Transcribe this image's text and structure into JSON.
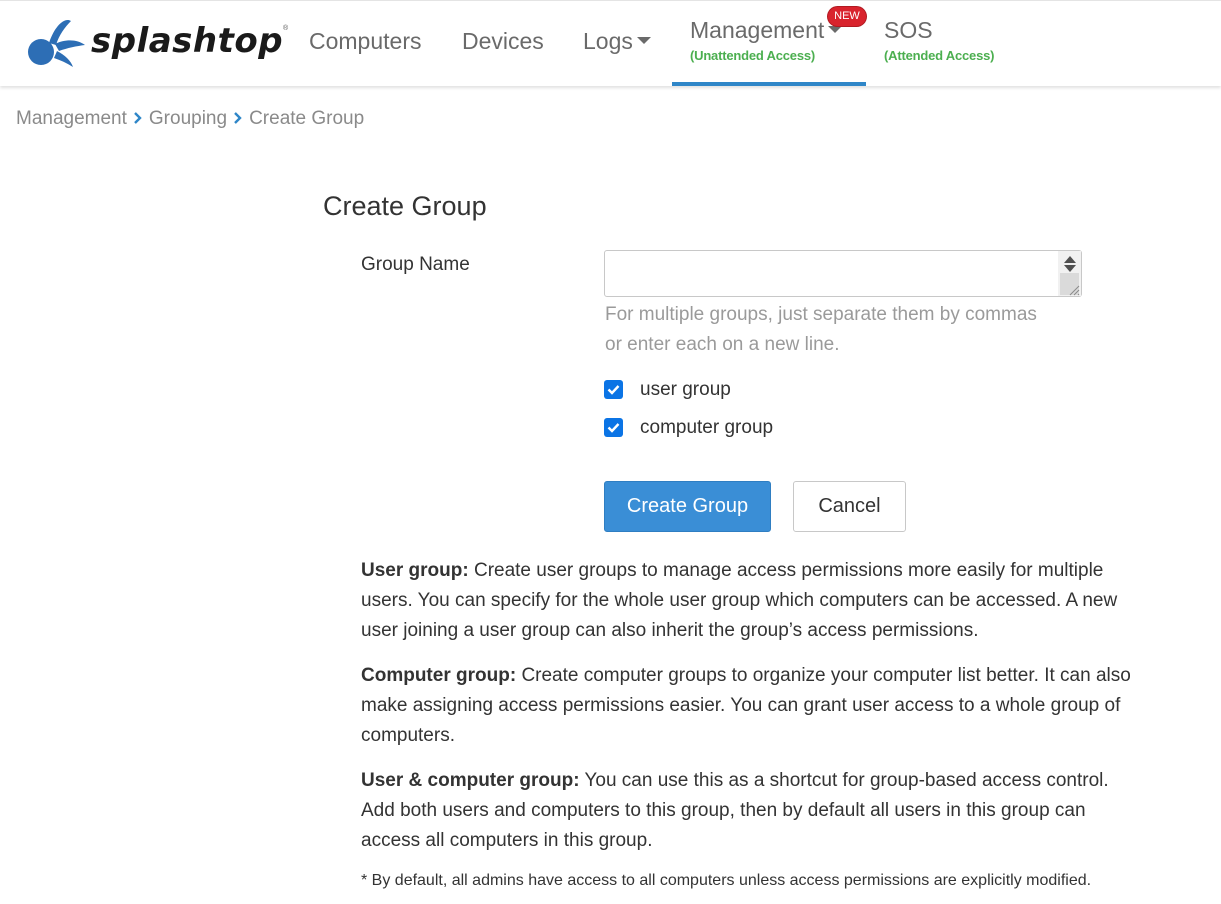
{
  "brand": {
    "name": "splashtop",
    "registered": "®"
  },
  "nav": {
    "computers": "Computers",
    "devices": "Devices",
    "logs": "Logs",
    "management": {
      "label": "Management",
      "sub": "(Unattended Access)",
      "badge": "NEW"
    },
    "sos": {
      "label": "SOS",
      "sub": "(Attended Access)"
    }
  },
  "breadcrumb": [
    "Management",
    "Grouping",
    "Create Group"
  ],
  "form": {
    "title": "Create Group",
    "group_name_label": "Group Name",
    "group_name_value": "",
    "hint_line1": "For multiple groups, just separate them by commas",
    "hint_line2": "or enter each on a new line.",
    "checkboxes": [
      {
        "label": "user group",
        "checked": true
      },
      {
        "label": "computer group",
        "checked": true
      }
    ],
    "create_button": "Create Group",
    "cancel_button": "Cancel"
  },
  "descriptions": [
    {
      "term": "User group:",
      "lines": [
        "Create user groups to manage access permissions more easily for multiple",
        "users. You can specify for the whole user group which computers can be accessed. A new",
        "user joining a user group can also inherit the group’s access permissions."
      ]
    },
    {
      "term": "Computer group:",
      "lines": [
        "Create computer groups to organize your computer list better. It can also",
        "make assigning access permissions easier. You can grant user access to a whole group of",
        "computers."
      ]
    },
    {
      "term": "User & computer group:",
      "lines": [
        "You can use this as a shortcut for group-based access control.",
        "Add both users and computers to this group, then by default all users in this group can",
        "access all computers in this group."
      ]
    }
  ],
  "footnote": "* By default, all admins have access to all computers unless access permissions are explicitly modified.",
  "colors": {
    "accent": "#2f86c8",
    "primary_button": "#3a8ed6",
    "checkbox": "#0b74e5",
    "nav_sub": "#4caf50",
    "badge": "#d9232d",
    "logo": "#2d6eb5"
  }
}
